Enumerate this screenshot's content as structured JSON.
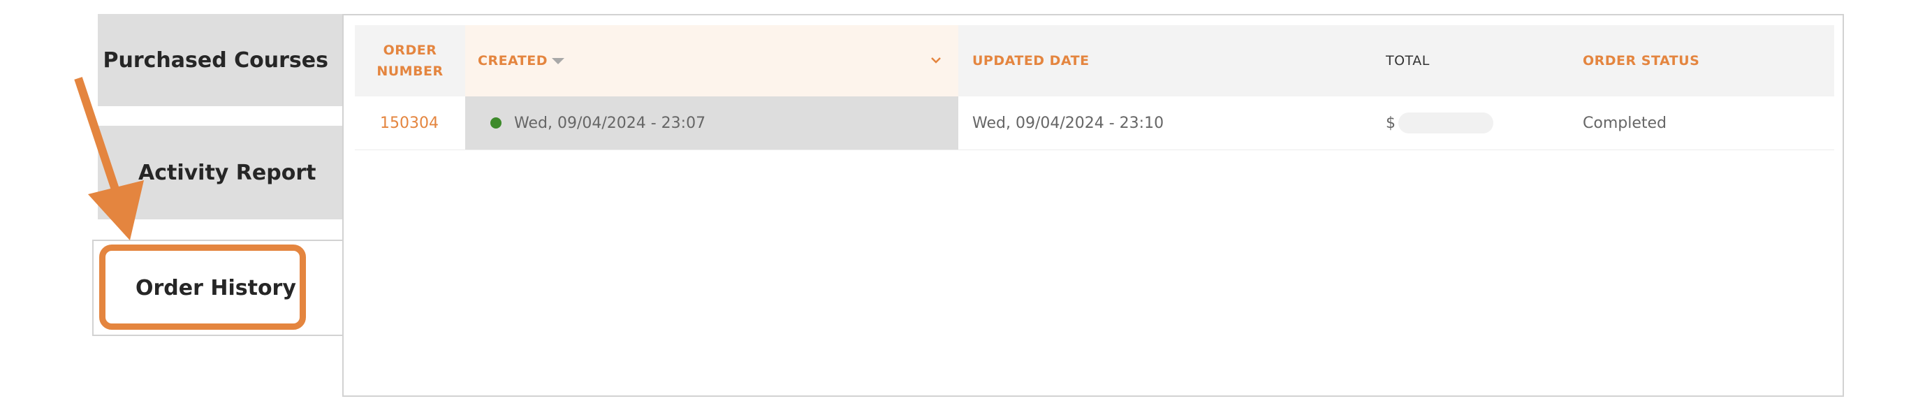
{
  "sidebar": {
    "tabs": [
      {
        "label": "Purchased Courses"
      },
      {
        "label": "Activity Report"
      },
      {
        "label": "Order History"
      }
    ]
  },
  "table": {
    "headers": {
      "order_number": "ORDER NUMBER",
      "created": "CREATED",
      "updated": "UPDATED DATE",
      "total": "TOTAL",
      "status": "ORDER STATUS"
    },
    "rows": [
      {
        "order_number": "150304",
        "created": "Wed, 09/04/2024 - 23:07",
        "updated": "Wed, 09/04/2024 - 23:10",
        "total_prefix": "$",
        "status": "Completed"
      }
    ]
  },
  "colors": {
    "accent": "#e4853f",
    "status_dot": "#3d8a2b"
  },
  "icons": {
    "sort": "sort-desc-icon",
    "chevron": "chevron-down-icon",
    "annotation": "arrow-annotation"
  }
}
